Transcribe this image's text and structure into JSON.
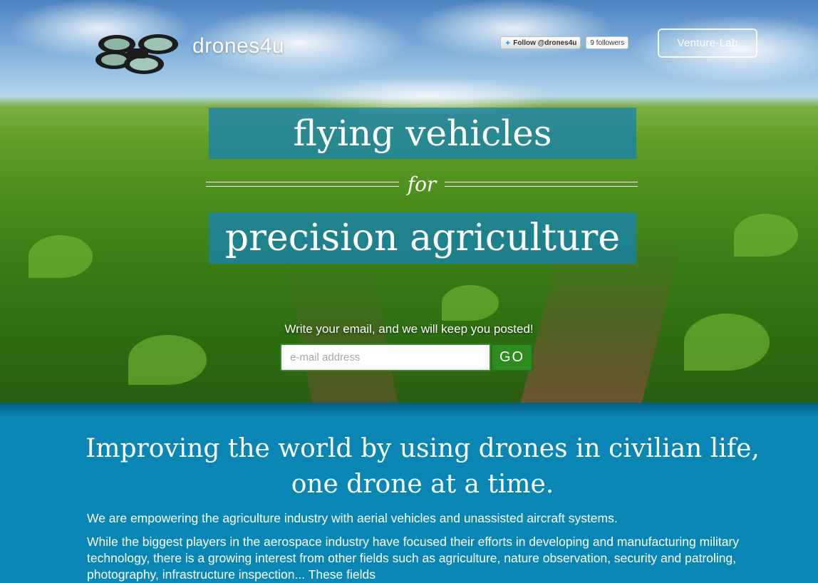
{
  "header": {
    "brand": "drones4u",
    "twitter_follow": "Follow @drones4u",
    "twitter_followers": "9 followers",
    "nav_button": "Venture-Lab"
  },
  "hero": {
    "line1": "flying vehicles",
    "connector": "for",
    "line2": "precision agriculture",
    "prompt": "Write your email, and we will keep you posted!",
    "email_placeholder": "e-mail address",
    "go_label": "GO"
  },
  "about": {
    "tagline": "Improving the world by using drones in civilian life, one drone at a time.",
    "paragraph1": "We are empowering the agriculture industry with aerial vehicles and unassisted aircraft systems.",
    "paragraph2": "While the biggest players in the aerospace industry have focused their efforts in developing and manufacturing military technology, there is a growing interest from other fields such as agriculture, nature observation, security and patroling, photography, infrastructure inspection... These fields"
  },
  "colors": {
    "hero_box": "#1482b4",
    "section_bg": "#0a86b5",
    "go_button": "#2e8c1e",
    "twitter_blue": "#2ba9e1"
  },
  "icons": {
    "logo": "quadcopter-logo-icon",
    "twitter": "twitter-bird-icon"
  }
}
